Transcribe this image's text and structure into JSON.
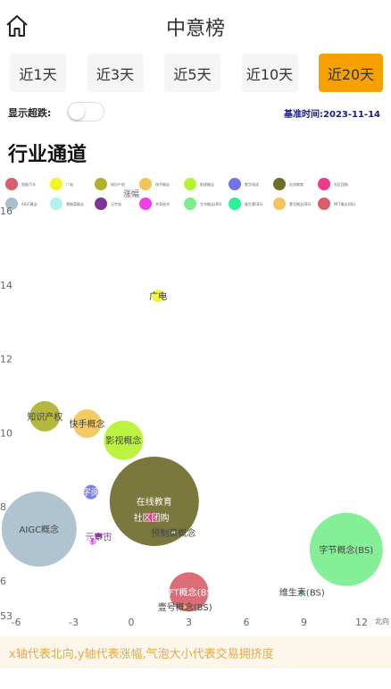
{
  "header": {
    "title": "中意榜"
  },
  "tabs": [
    {
      "label": "近1天",
      "active": false
    },
    {
      "label": "近3天",
      "active": false
    },
    {
      "label": "近5天",
      "active": false
    },
    {
      "label": "近10天",
      "active": false
    },
    {
      "label": "近20天",
      "active": true
    }
  ],
  "options": {
    "show_limit_label": "显示超跌:",
    "show_limit_on": false,
    "base_date": "基准时间:2023-11-14"
  },
  "section": {
    "title": "行业通道",
    "footnote": "x轴代表北向,y轴代表涨幅,气泡大小代表交易拥挤度"
  },
  "chart_data": {
    "type": "scatter",
    "xlabel": "北向",
    "ylabel": "涨幅",
    "xlim": [
      -6,
      13.5
    ],
    "ylim": [
      5.3,
      16
    ],
    "xticks": [
      -6,
      -3,
      0,
      3,
      6,
      9,
      12
    ],
    "xtick_labels": [
      "-6",
      "-3",
      "0",
      "3",
      "6",
      "9",
      "12"
    ],
    "yticks": [
      6,
      8,
      10,
      12,
      14,
      16
    ],
    "ytick_labels": [
      "6",
      "8",
      "10",
      "12",
      "14",
      "16"
    ],
    "corner_label": "53",
    "legend": [
      {
        "name": "智能汽车",
        "color": "#d9606a"
      },
      {
        "name": "广电",
        "color": "#f2f522"
      },
      {
        "name": "知识产权",
        "color": "#b0b12c"
      },
      {
        "name": "快手概念",
        "color": "#f3c558"
      },
      {
        "name": "影视概念",
        "color": "#b5f230"
      },
      {
        "name": "数字阅读",
        "color": "#7474e6"
      },
      {
        "name": "在线教育",
        "color": "#6f6c2c"
      },
      {
        "name": "社区团购",
        "color": "#ee3a8c"
      },
      {
        "name": "AIGC概念",
        "color": "#a8bfcc"
      },
      {
        "name": "预制菜概念",
        "color": "#b4f1ee"
      },
      {
        "name": "元宇宙",
        "color": "#7a3596"
      },
      {
        "name": "共享经济",
        "color": "#ee3fe8"
      },
      {
        "name": "字节概念(BS)",
        "color": "#7bee8e"
      },
      {
        "name": "维生素(BS)",
        "color": "#2ff09a"
      },
      {
        "name": "壹号概念(BS)",
        "color": "#f2c464"
      },
      {
        "name": "NFT概念(BS)",
        "color": "#d9606a"
      }
    ],
    "points": [
      {
        "name": "广电",
        "x": 1.4,
        "y": 13.7,
        "size": 7,
        "color": "#f2f522",
        "label_color": "#333333"
      },
      {
        "name": "知识产权",
        "x": -4.5,
        "y": 10.45,
        "size": 17,
        "color": "#b0b12c",
        "label_color": "#444444"
      },
      {
        "name": "快手概念",
        "x": -2.3,
        "y": 10.25,
        "size": 16,
        "color": "#f3c558",
        "label_color": "#444444"
      },
      {
        "name": "影视概念",
        "x": -0.4,
        "y": 9.8,
        "size": 22,
        "color": "#b5f230",
        "label_color": "#444444"
      },
      {
        "name": "数字阅读",
        "x": -2.1,
        "y": 8.4,
        "size": 8,
        "color": "#7474e6",
        "label_color": "#ffffff"
      },
      {
        "name": "在线教育",
        "x": 1.2,
        "y": 8.15,
        "size": 50,
        "color": "#6f6c2c",
        "label_color": "#ffffff"
      },
      {
        "name": "社区团购",
        "x": 1.05,
        "y": 7.72,
        "size": 6,
        "color": "#ee3a8c",
        "label_color": "#ffffff"
      },
      {
        "name": "预制菜概念",
        "x": 2.2,
        "y": 7.3,
        "size": 2,
        "color": "#b4f1ee",
        "label_color": "#444444"
      },
      {
        "name": "元宇宙",
        "x": -1.7,
        "y": 7.2,
        "size": 4,
        "color": "#7a3596",
        "label_color": "#7a3596"
      },
      {
        "name": "共享经济",
        "x": -2.0,
        "y": 7.07,
        "size": 4,
        "color": "#ee3fe8",
        "label_color": "#ffffff"
      },
      {
        "name": "AIGC概念",
        "x": -4.8,
        "y": 7.4,
        "size": 42,
        "color": "#a8bfcc",
        "label_color": "#444444"
      },
      {
        "name": "字节概念(BS)",
        "x": 11.2,
        "y": 6.85,
        "size": 41,
        "color": "#7bee8e",
        "label_color": "#444444"
      },
      {
        "name": "NFT概念(BS)",
        "x": 3.0,
        "y": 5.7,
        "size": 22,
        "color": "#d9606a",
        "label_color": "#ffffff"
      },
      {
        "name": "维生素(BS)",
        "x": 8.9,
        "y": 5.7,
        "size": 2,
        "color": "#2ff09a",
        "label_color": "#444444"
      },
      {
        "name": "壹号概念(BS)",
        "x": 2.8,
        "y": 5.3,
        "size": 2,
        "color": "#f2c464",
        "label_color": "#444444"
      }
    ]
  }
}
